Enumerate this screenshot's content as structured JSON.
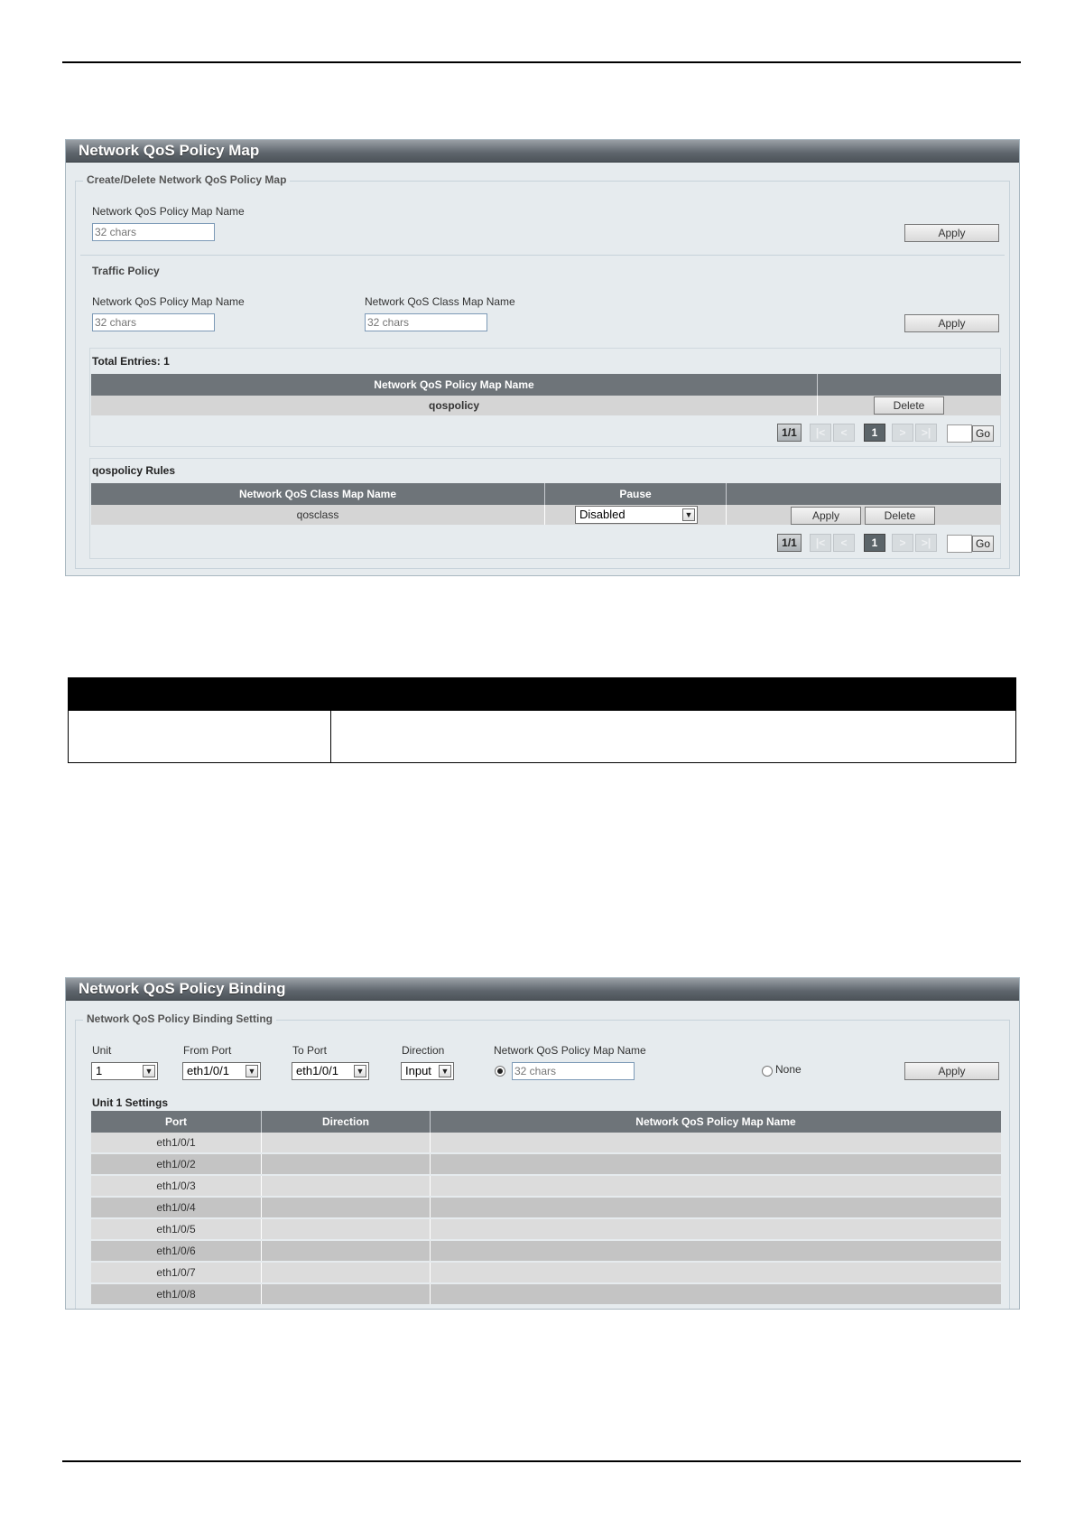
{
  "policy_map": {
    "title": "Network QoS Policy Map",
    "create_legend": "Create/Delete Network QoS Policy Map",
    "name_label": "Network QoS Policy Map Name",
    "name_placeholder": "32 chars",
    "apply_label": "Apply",
    "traffic_policy_label": "Traffic Policy",
    "tp_policy_name_label": "Network QoS Policy Map Name",
    "tp_class_name_label": "Network QoS Class Map Name",
    "tp_policy_placeholder": "32 chars",
    "tp_class_placeholder": "32 chars",
    "tp_apply_label": "Apply",
    "total_entries": "Total Entries: 1",
    "table_header": "Network QoS Policy Map Name",
    "rows": [
      {
        "name": "qospolicy",
        "delete_label": "Delete"
      }
    ],
    "pager": {
      "page_label": "1/1",
      "first": "|<",
      "prev": "<",
      "current": "1",
      "next": ">",
      "last": ">|",
      "go": "Go"
    }
  },
  "rules": {
    "title": "qospolicy Rules",
    "headers": [
      "Network QoS Class Map Name",
      "Pause",
      ""
    ],
    "rows": [
      {
        "class_name": "qosclass",
        "pause": "Disabled",
        "apply_label": "Apply",
        "delete_label": "Delete"
      }
    ],
    "pager": {
      "page_label": "1/1",
      "first": "|<",
      "prev": "<",
      "current": "1",
      "next": ">",
      "last": ">|",
      "go": "Go"
    }
  },
  "binding": {
    "title": "Network QoS Policy Binding",
    "legend": "Network QoS Policy Binding Setting",
    "unit_label": "Unit",
    "unit_value": "1",
    "from_port_label": "From Port",
    "from_port_value": "eth1/0/1",
    "to_port_label": "To Port",
    "to_port_value": "eth1/0/1",
    "direction_label": "Direction",
    "direction_value": "Input",
    "policy_name_label": "Network QoS Policy Map Name",
    "policy_name_placeholder": "32 chars",
    "none_label": "None",
    "apply_label": "Apply",
    "settings_title": "Unit 1 Settings",
    "headers": [
      "Port",
      "Direction",
      "Network QoS Policy Map Name"
    ],
    "rows": [
      {
        "port": "eth1/0/1",
        "direction": "",
        "policy": ""
      },
      {
        "port": "eth1/0/2",
        "direction": "",
        "policy": ""
      },
      {
        "port": "eth1/0/3",
        "direction": "",
        "policy": ""
      },
      {
        "port": "eth1/0/4",
        "direction": "",
        "policy": ""
      },
      {
        "port": "eth1/0/5",
        "direction": "",
        "policy": ""
      },
      {
        "port": "eth1/0/6",
        "direction": "",
        "policy": ""
      },
      {
        "port": "eth1/0/7",
        "direction": "",
        "policy": ""
      },
      {
        "port": "eth1/0/8",
        "direction": "",
        "policy": ""
      }
    ]
  },
  "colors": {
    "header_bg": "#6e7479",
    "panel_bg": "#e6ebee",
    "row_odd": "#dcdcdc",
    "row_even": "#c4c4c4",
    "black_bar": "#000000"
  }
}
